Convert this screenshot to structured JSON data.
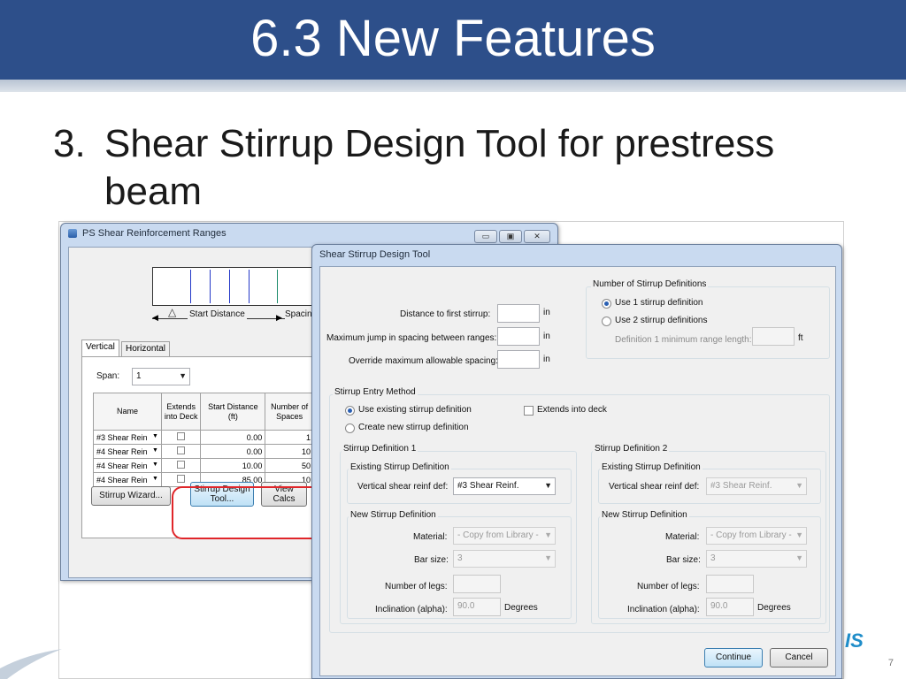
{
  "slide": {
    "title": "6.3 New Features",
    "bullet_number": "3.",
    "bullet_text": "Shear Stirrup Design Tool for prestress beam",
    "page_number": "7",
    "logo_fragment": "IS"
  },
  "ps_window": {
    "title": "PS Shear Reinforcement Ranges",
    "start_distance_label": "Start Distance",
    "spacing_label": "Spacing",
    "tabs": [
      "Vertical",
      "Horizontal"
    ],
    "span_label": "Span:",
    "span_value": "1",
    "columns": [
      "Name",
      "Extends into Deck",
      "Start Distance (ft)",
      "Number of Spaces"
    ],
    "rows": [
      {
        "name": "#3 Shear Rein",
        "start": "0.00",
        "spaces": "1"
      },
      {
        "name": "#4 Shear Rein",
        "start": "0.00",
        "spaces": "10"
      },
      {
        "name": "#4 Shear Rein",
        "start": "10.00",
        "spaces": "50"
      },
      {
        "name": "#4 Shear Rein",
        "start": "85.00",
        "spaces": "10"
      }
    ],
    "stirrup_wizard_label": "Stirrup Wizard...",
    "design_tool_label_1": "Stirrup Design",
    "design_tool_label_2": "Tool...",
    "view_calcs_label_1": "View",
    "view_calcs_label_2": "Calcs"
  },
  "tool_window": {
    "title": "Shear Stirrup Design Tool",
    "distance_first_label": "Distance to first stirrup:",
    "max_jump_label": "Maximum jump in spacing between ranges:",
    "override_label": "Override maximum allowable spacing:",
    "unit_in": "in",
    "unit_ft": "ft",
    "num_defs_group": "Number of Stirrup Definitions",
    "use_one_label": "Use 1 stirrup definition",
    "use_two_label": "Use 2 stirrup definitions",
    "def1_min_label": "Definition 1 minimum range length:",
    "entry_method_group": "Stirrup Entry Method",
    "use_existing_label": "Use existing stirrup definition",
    "create_new_label": "Create new stirrup definition",
    "extends_deck_label": "Extends into deck",
    "def1_group": "Stirrup Definition 1",
    "def2_group": "Stirrup Definition 2",
    "existing_def_group": "Existing Stirrup Definition",
    "vertical_def_label": "Vertical shear reinf def:",
    "def1_vertical_value": "#3 Shear Reinf.",
    "def2_vertical_value": "#3 Shear Reinf.",
    "new_def_group": "New Stirrup Definition",
    "material_label": "Material:",
    "material_value": "- Copy from Library -",
    "bar_size_label": "Bar size:",
    "bar_size_value": "3",
    "num_legs_label": "Number of legs:",
    "inclination_label": "Inclination (alpha):",
    "inclination_value": "90.0",
    "degrees_label": "Degrees",
    "continue_label": "Continue",
    "cancel_label": "Cancel"
  }
}
